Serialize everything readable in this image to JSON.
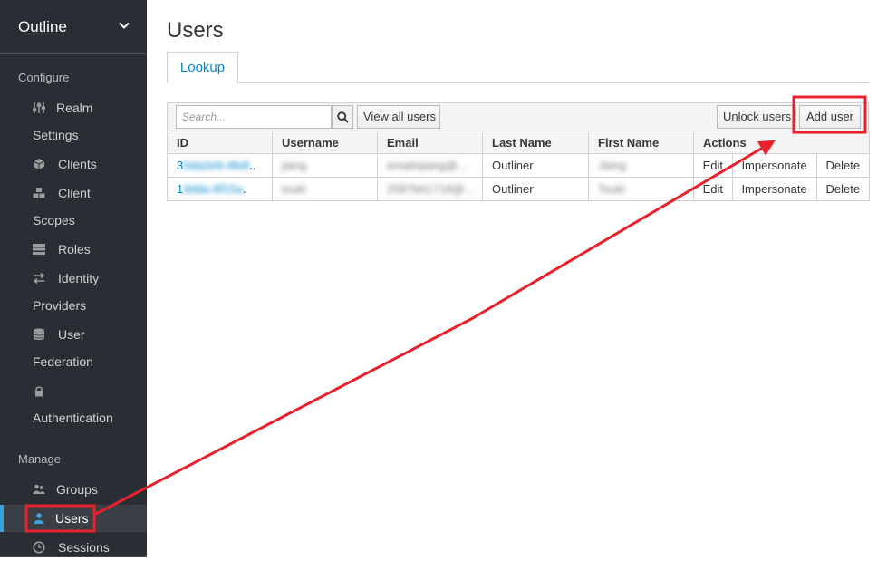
{
  "sidebar": {
    "realm_name": "Outline",
    "configure_title": "Configure",
    "manage_title": "Manage",
    "configure_items": [
      {
        "line1": "Realm",
        "line2": "Settings"
      },
      {
        "line1": "Clients",
        "line2": ""
      },
      {
        "line1": "Client",
        "line2": "Scopes"
      },
      {
        "line1": "Roles",
        "line2": ""
      },
      {
        "line1": "Identity",
        "line2": "Providers"
      },
      {
        "line1": "User",
        "line2": "Federation"
      },
      {
        "line1": "",
        "line2": "Authentication"
      }
    ],
    "manage_items": [
      {
        "label": "Groups"
      },
      {
        "label": "Users"
      },
      {
        "label": "Sessions"
      }
    ]
  },
  "main": {
    "title": "Users",
    "tabs": [
      {
        "label": "Lookup"
      }
    ],
    "toolbar": {
      "search_placeholder": "Search...",
      "view_all_label": "View all users",
      "unlock_label": "Unlock users",
      "add_user_label": "Add user"
    },
    "table": {
      "columns": [
        "ID",
        "Username",
        "Email",
        "Last Name",
        "First Name",
        "Actions"
      ],
      "rows": [
        {
          "id_prefix": "3",
          "id_rest": "0da2e9-4fe8",
          "id_suffix": "..",
          "username": "jiang",
          "email": "emailxjiang@...",
          "last_name": "Outliner",
          "first_name": "Jiang",
          "actions": [
            "Edit",
            "Impersonate",
            "Delete"
          ]
        },
        {
          "id_prefix": "1",
          "id_rest": "9dda-8f15a",
          "id_suffix": ".",
          "username": "tsuki",
          "email": "2587b61718@...",
          "last_name": "Outliner",
          "first_name": "Tsuki",
          "actions": [
            "Edit",
            "Impersonate",
            "Delete"
          ]
        }
      ]
    }
  },
  "colors": {
    "sidebar_bg": "#292e34",
    "active_item_bg": "#393f44",
    "accent_blue": "#0088ce",
    "annotation_red": "#e8212c"
  }
}
